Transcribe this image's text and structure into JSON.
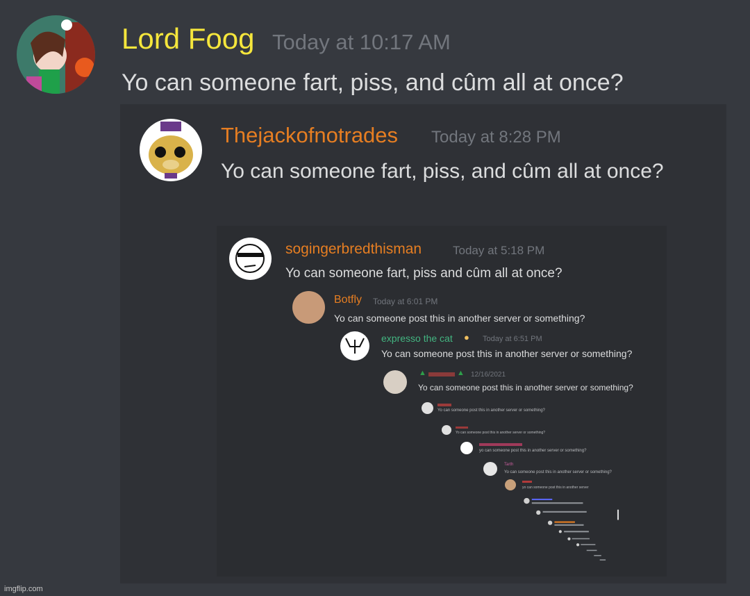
{
  "colors": {
    "background": "#36393f",
    "embed_bg": "#2f3136",
    "name_yellow": "#f5e63c",
    "name_orange": "#e67e22",
    "name_green": "#43b581",
    "name_red": "#ed4245",
    "name_pink": "#c75d9c",
    "timestamp": "#72767d",
    "text": "#dcddde"
  },
  "top_message": {
    "author": "Lord Foog",
    "timestamp": "Today at 10:17 AM",
    "text": "Yo can someone fart, piss, and cûm all at once?"
  },
  "quoted_1": {
    "author": "Thejackofnotrades",
    "timestamp": "Today at 8:28 PM",
    "text": "Yo can someone fart, piss, and cûm all at once?"
  },
  "quoted_2": {
    "author": "sogingerbredthisman",
    "timestamp": "Today at 5:18 PM",
    "text": "Yo can someone fart, piss and cûm all at once?"
  },
  "quoted_3": {
    "author": "Botfly",
    "timestamp": "Today at 6:01 PM",
    "text": "Yo can someone post this in another server or something?"
  },
  "quoted_4": {
    "author": "expresso the cat",
    "timestamp": "Today at 6:51 PM",
    "text": "Yo can someone post this in another server or something?"
  },
  "quoted_5": {
    "timestamp": "12/16/2021",
    "text": "Yo can someone post this in another server or something?"
  },
  "quoted_6": {
    "text": "Yo can someone post this in another server or something?"
  },
  "quoted_7": {
    "text": "Yo can someone post this in another server or something?"
  },
  "quoted_8": {
    "text": "yo can someone post this in another server or something?"
  },
  "quoted_9": {
    "author": "Tarth",
    "text": "Yo can someone post this in another server or something?"
  },
  "quoted_10": {
    "text": "yo can someone post this in another server"
  },
  "watermark": "imgflip.com"
}
